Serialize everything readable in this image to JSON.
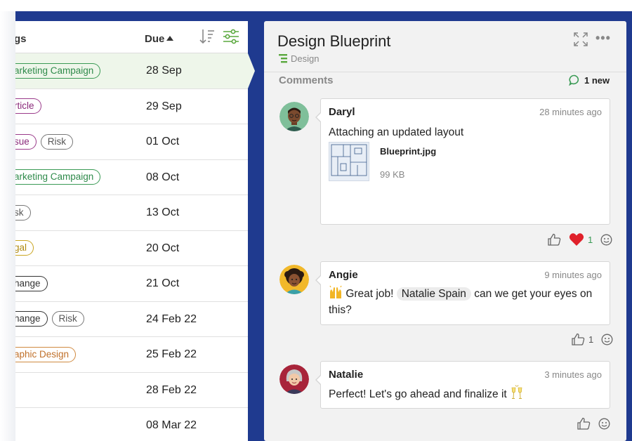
{
  "list": {
    "col_tags": "gs",
    "col_due": "Due",
    "rows": [
      {
        "tags": [
          {
            "label": "arketing Campaign",
            "cls": "t-green"
          }
        ],
        "due": "28 Sep",
        "selected": true
      },
      {
        "tags": [
          {
            "label": "rticle",
            "cls": "t-purple"
          }
        ],
        "due": "29 Sep"
      },
      {
        "tags": [
          {
            "label": "sue",
            "cls": "t-purple"
          },
          {
            "label": "Risk",
            "cls": "t-gray"
          }
        ],
        "due": "01 Oct"
      },
      {
        "tags": [
          {
            "label": "arketing Campaign",
            "cls": "t-green"
          }
        ],
        "due": "08 Oct"
      },
      {
        "tags": [
          {
            "label": "sk",
            "cls": "t-gray"
          }
        ],
        "due": "13 Oct"
      },
      {
        "tags": [
          {
            "label": "gal",
            "cls": "t-yellow"
          }
        ],
        "due": "20 Oct"
      },
      {
        "tags": [
          {
            "label": "hange",
            "cls": "t-dark"
          }
        ],
        "due": "21 Oct"
      },
      {
        "tags": [
          {
            "label": "hange",
            "cls": "t-dark"
          },
          {
            "label": "Risk",
            "cls": "t-gray"
          }
        ],
        "due": "24 Feb 22"
      },
      {
        "tags": [
          {
            "label": "aphic Design",
            "cls": "t-orange"
          }
        ],
        "due": "25 Feb 22"
      },
      {
        "tags": [],
        "due": "28 Feb 22"
      },
      {
        "tags": [],
        "due": "08 Mar 22"
      }
    ]
  },
  "detail": {
    "title": "Design Blueprint",
    "category": "Design",
    "comments_label": "Comments",
    "new_count": "1 new",
    "more_label": "•••"
  },
  "comments": [
    {
      "name": "Daryl",
      "time": "28 minutes ago",
      "text": "Attaching an updated layout",
      "attachment": {
        "name": "Blueprint.jpg",
        "size": "99 KB"
      },
      "reactions": {
        "heart_count": "1"
      }
    },
    {
      "name": "Angie",
      "time": "9 minutes ago",
      "text_before": "Great job!",
      "mention": "Natalie Spain",
      "text_after": "can we get your eyes on this?",
      "reactions": {
        "like_count": "1"
      }
    },
    {
      "name": "Natalie",
      "time": "3 minutes ago",
      "text": "Perfect! Let's go ahead and finalize it"
    }
  ],
  "colors": {
    "accent_green": "#3a9a55",
    "background_blue": "#1f3a8f",
    "heart_red": "#e0202a"
  }
}
